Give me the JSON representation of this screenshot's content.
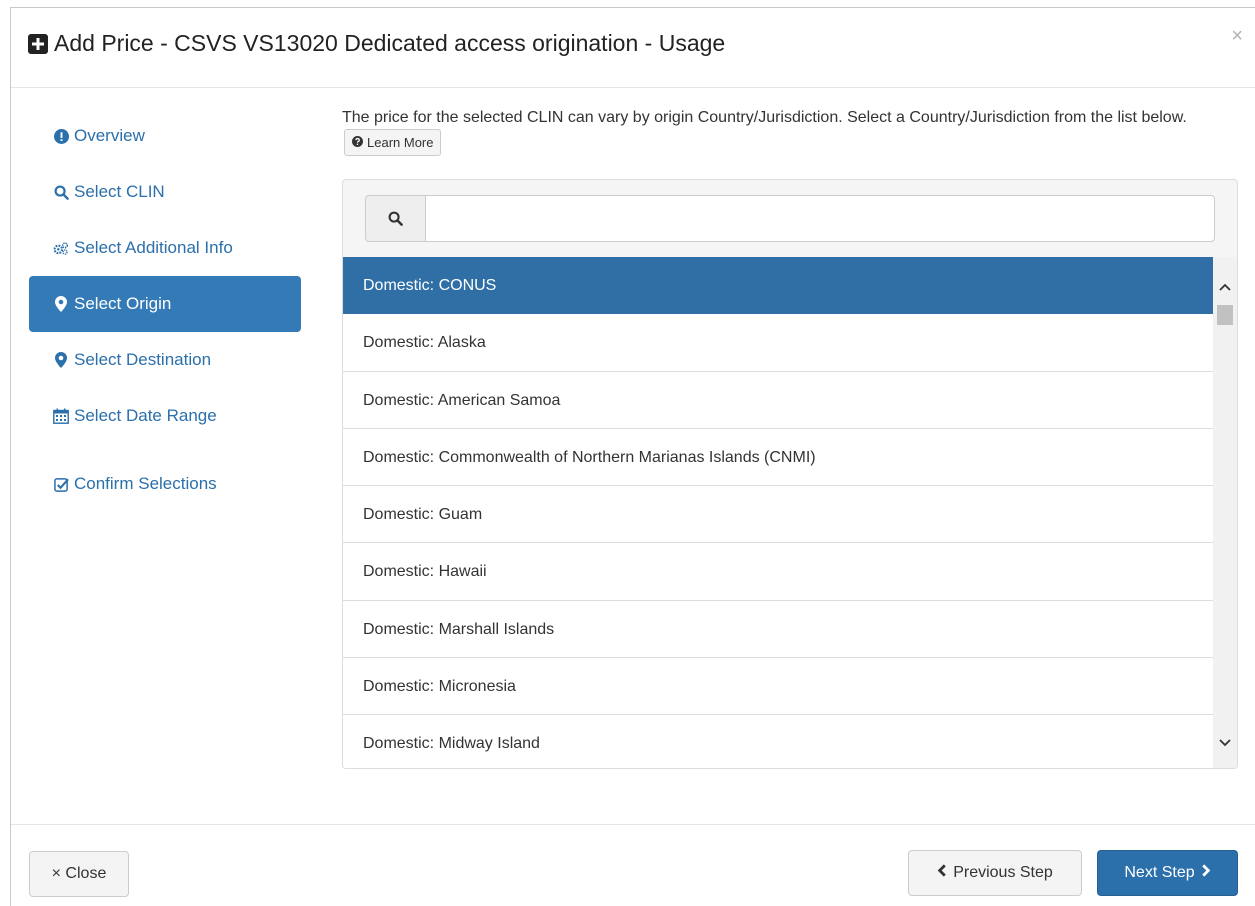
{
  "dialog": {
    "title": "Add Price - CSVS VS13020 Dedicated access origination - Usage",
    "close_symbol": "×",
    "title_icon": "plus-square-icon"
  },
  "sidebar": {
    "items": [
      {
        "label": "Overview",
        "icon": "exclamation-circle-icon"
      },
      {
        "label": "Select CLIN",
        "icon": "search-icon"
      },
      {
        "label": "Select Additional Info",
        "icon": "gears-icon"
      },
      {
        "label": "Select Origin",
        "icon": "map-marker-icon",
        "active": true
      },
      {
        "label": "Select Destination",
        "icon": "map-marker-icon"
      },
      {
        "label": "Select Date Range",
        "icon": "calendar-icon"
      },
      {
        "label": "Confirm Selections",
        "icon": "check-square-icon"
      }
    ]
  },
  "content": {
    "intro": "The price for the selected CLIN can vary by origin Country/Jurisdiction. Select a Country/Jurisdiction from the list below.",
    "learn_more": "Learn More",
    "search": {
      "placeholder": "",
      "value": ""
    },
    "list": [
      "Domestic: CONUS",
      "Domestic: Alaska",
      "Domestic: American Samoa",
      "Domestic: Commonwealth of Northern Marianas Islands (CNMI)",
      "Domestic: Guam",
      "Domestic: Hawaii",
      "Domestic: Marshall Islands",
      "Domestic: Micronesia",
      "Domestic: Midway Island"
    ],
    "selected_index": 0
  },
  "footer": {
    "close_label": "× Close",
    "previous_label": "Previous Step",
    "next_label": "Next Step"
  },
  "colors": {
    "primary": "#337ab7",
    "selected_row": "#2f6fa6",
    "link": "#2b6fab"
  }
}
